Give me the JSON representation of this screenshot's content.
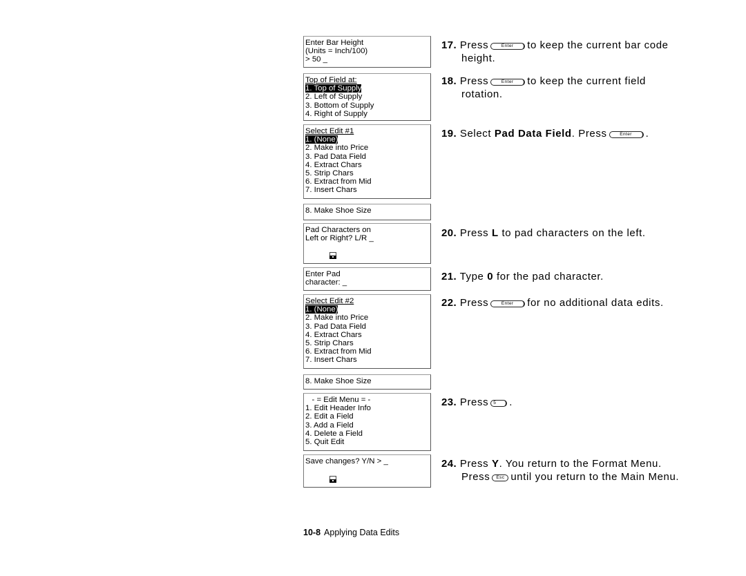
{
  "screens": [
    {
      "lines": [
        "Enter Bar Height",
        "(Units = Inch/100)",
        "> 50 _"
      ],
      "selected_index": null
    },
    {
      "lines": [
        "Top of Field at:",
        "1. Top of Supply",
        "2. Left of Supply",
        "3. Bottom of Supply",
        "4. Right of Supply"
      ],
      "selected_index": 1
    },
    {
      "lines": [
        "Select Edit #1",
        "1. (None)",
        "2. Make into Price",
        "3. Pad Data Field",
        "4. Extract Chars",
        "5. Strip Chars",
        "6. Extract from Mid",
        "7. Insert Chars"
      ],
      "selected_index": 1
    },
    {
      "lines": [
        "8. Make Shoe Size"
      ],
      "selected_index": null
    },
    {
      "lines": [
        "Pad Characters on",
        "Left or Right? L/R _"
      ],
      "selected_index": null,
      "icon": "cursor-block-icon"
    },
    {
      "lines": [
        "Enter Pad",
        "character: _"
      ],
      "selected_index": null
    },
    {
      "lines": [
        "Select Edit #2",
        "1. (None)",
        "2. Make into Price",
        "3. Pad Data Field",
        "4. Extract Chars",
        "5. Strip Chars",
        "6. Extract from Mid",
        "7. Insert Chars"
      ],
      "selected_index": 1
    },
    {
      "lines": [
        "8. Make Shoe Size"
      ],
      "selected_index": null
    },
    {
      "lines": [
        "   - = Edit Menu = -",
        "1. Edit Header Info",
        "2. Edit a Field",
        "3. Add a Field",
        "4. Delete a Field",
        "5. Quit Edit"
      ],
      "selected_index": null
    },
    {
      "lines": [
        "Save changes? Y/N > _"
      ],
      "selected_index": null,
      "icon": "cursor-block-icon"
    }
  ],
  "keys": {
    "enter": "Enter",
    "five": "5",
    "esc": "Esc"
  },
  "steps": {
    "s17": {
      "num": "17.",
      "a": "Press",
      "b": "to keep the current bar code",
      "c": "height."
    },
    "s18": {
      "num": "18.",
      "a": "Press",
      "b": "to keep the current field",
      "c": "rotation."
    },
    "s19": {
      "num": "19.",
      "a": "Select",
      "bold": "Pad Data Field",
      "b": ".  Press",
      "c": "."
    },
    "s20": {
      "num": "20.",
      "a": "Press",
      "bold": "L",
      "b": "to pad characters on the left."
    },
    "s21": {
      "num": "21.",
      "a": "Type",
      "bold": "0",
      "b": "for the pad character."
    },
    "s22": {
      "num": "22.",
      "a": "Press",
      "b": "for no additional data edits."
    },
    "s23": {
      "num": "23.",
      "a": "Press",
      "b": "."
    },
    "s24": {
      "num": "24.",
      "a": "Press",
      "bold": "Y",
      "b": ".  You return to the Format Menu.",
      "c": "Press",
      "d": "until you return to the Main Menu."
    }
  },
  "footer": {
    "page": "10-8",
    "title": "Applying Data Edits"
  }
}
